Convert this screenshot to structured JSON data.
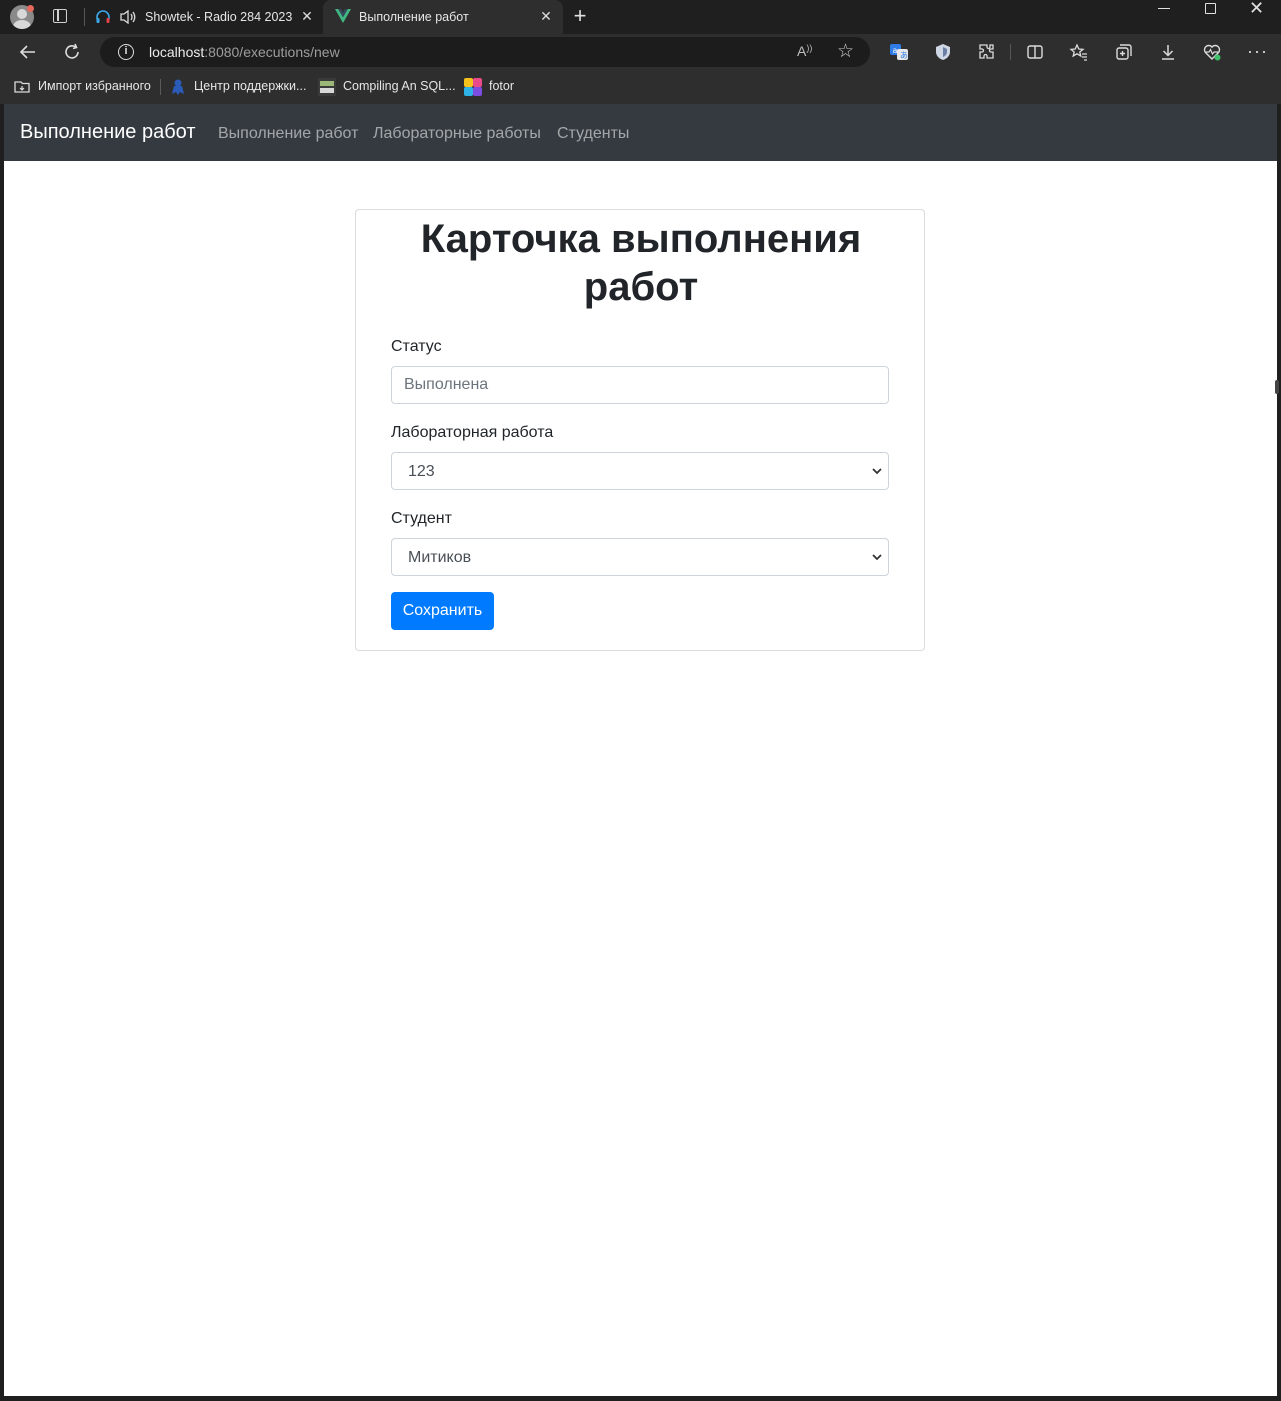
{
  "tabs": [
    {
      "title": "Showtek - Radio 284 2023-",
      "active": false
    },
    {
      "title": "Выполнение работ",
      "active": true
    }
  ],
  "address": {
    "host": "localhost",
    "path": ":8080/executions/new"
  },
  "bookmarks": [
    {
      "label": "Импорт избранного"
    },
    {
      "label": "Центр поддержки..."
    },
    {
      "label": "Compiling An SQL..."
    },
    {
      "label": "fotor"
    }
  ],
  "navbar": {
    "brand": "Выполнение работ",
    "links": [
      "Выполнение работ",
      "Лабораторные работы",
      "Студенты"
    ]
  },
  "form": {
    "title": "Карточка выполнения работ",
    "status_label": "Статус",
    "status_placeholder": "Выполнена",
    "lab_label": "Лабораторная работа",
    "lab_value": "123",
    "student_label": "Студент",
    "student_value": "Митиков",
    "save_label": "Сохранить"
  },
  "colors": {
    "navbar_bg": "#343a40",
    "primary": "#007bff",
    "browser_chrome": "#2e2e2e"
  }
}
